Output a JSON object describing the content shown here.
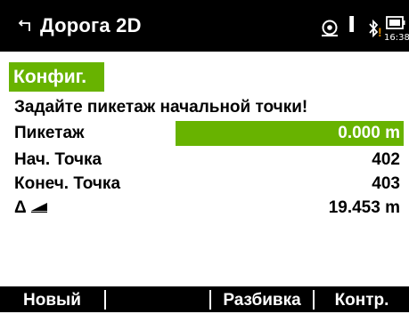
{
  "header": {
    "title": "Дорога 2D",
    "back_icon": "return-arrow-icon",
    "status": {
      "icons": [
        "target-cursor-icon",
        "ibeam-icon",
        "bluetooth-icon",
        "battery-icon"
      ],
      "warning_mark": "!",
      "time": "16:38"
    }
  },
  "tab": {
    "label": "Конфиг."
  },
  "prompt": "Задайте пикетаж начальной точки!",
  "fields": [
    {
      "label": "Пикетаж",
      "value": "0.000 m"
    },
    {
      "label": "Нач. Точка",
      "value": "402"
    },
    {
      "label": "Конеч. Точка",
      "value": "403"
    },
    {
      "label": "Δ",
      "value": "19.453 m",
      "icon": "slope-triangle-icon"
    }
  ],
  "softkeys": [
    "Новый",
    "",
    "Разбивка",
    "Контр."
  ],
  "colors": {
    "accent": "#68b300",
    "bar": "#000000",
    "warning": "#e08a00"
  }
}
